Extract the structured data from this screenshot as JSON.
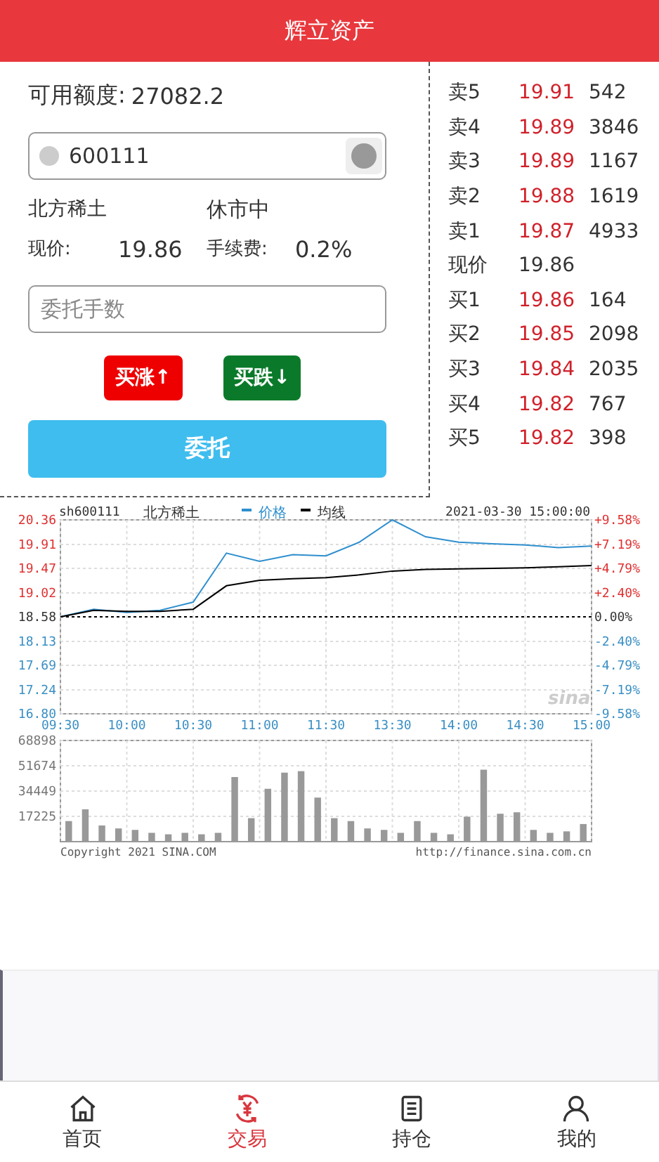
{
  "header": {
    "title": "辉立资产"
  },
  "account": {
    "label": "可用额度:",
    "value": "27082.2"
  },
  "code_field": {
    "value": "600111"
  },
  "stock": {
    "name": "北方稀土",
    "status": "休市中",
    "price_label": "现价:",
    "price": "19.86",
    "fee_label": "手续费:",
    "fee": "0.2%"
  },
  "quantity_field": {
    "placeholder": "委托手数"
  },
  "trade_buttons": [
    {
      "label": "买涨↑",
      "kind": "up"
    },
    {
      "label": "买跌↓",
      "kind": "down"
    }
  ],
  "submit_button": {
    "label": "委托"
  },
  "order_book": [
    {
      "label": "卖5",
      "price": "19.91",
      "volume": "542",
      "kind": "quote"
    },
    {
      "label": "卖4",
      "price": "19.89",
      "volume": "3846",
      "kind": "quote"
    },
    {
      "label": "卖3",
      "price": "19.89",
      "volume": "1167",
      "kind": "quote"
    },
    {
      "label": "卖2",
      "price": "19.88",
      "volume": "1619",
      "kind": "quote"
    },
    {
      "label": "卖1",
      "price": "19.87",
      "volume": "4933",
      "kind": "quote"
    },
    {
      "label": "现价",
      "price": "19.86",
      "kind": "current"
    },
    {
      "label": "买1",
      "price": "19.86",
      "volume": "164",
      "kind": "quote"
    },
    {
      "label": "买2",
      "price": "19.85",
      "volume": "2098",
      "kind": "quote"
    },
    {
      "label": "买3",
      "price": "19.84",
      "volume": "2035",
      "kind": "quote"
    },
    {
      "label": "买4",
      "price": "19.82",
      "volume": "767",
      "kind": "quote"
    },
    {
      "label": "买5",
      "price": "19.82",
      "volume": "398",
      "kind": "quote"
    }
  ],
  "price_chart": {
    "symbol": "sh600111",
    "name": "北方稀土",
    "datetime": "2021-03-30 15:00:00",
    "logo": "sina",
    "percent_ticks": [
      "+9.58%",
      "+7.19%",
      "+4.79%",
      "+2.40%",
      "0.00%",
      "-2.40%",
      "-4.79%",
      "-7.19%",
      "-9.58%"
    ],
    "chart_data": {
      "type": "line",
      "categories": [
        "09:30",
        null,
        "10:00",
        null,
        "10:30",
        null,
        "11:00",
        null,
        "11:30",
        null,
        "13:30",
        null,
        "14:00",
        null,
        "14:30",
        null,
        "15:00"
      ],
      "series": [
        {
          "name": "价格",
          "color": "#2f8fce",
          "values": [
            18.58,
            18.72,
            18.66,
            18.7,
            18.85,
            19.75,
            19.6,
            19.72,
            19.7,
            19.95,
            20.36,
            20.05,
            19.95,
            19.92,
            19.9,
            19.85,
            19.88
          ]
        },
        {
          "name": "均线",
          "color": "#000000",
          "values": [
            18.58,
            18.7,
            18.68,
            18.68,
            18.72,
            19.15,
            19.25,
            19.28,
            19.3,
            19.35,
            19.42,
            19.45,
            19.46,
            19.47,
            19.48,
            19.5,
            19.52
          ]
        }
      ],
      "ylim": [
        16.8,
        20.36
      ],
      "grid": true,
      "legend": "top",
      "ref_lines": [
        {
          "axis": "y",
          "value": 18.58
        }
      ],
      "yticks": [
        {
          "value": 20.36,
          "label": "20.36"
        },
        {
          "value": 19.91,
          "label": "19.91"
        },
        {
          "value": 19.47,
          "label": "19.47"
        },
        {
          "value": 19.02,
          "label": "19.02"
        },
        {
          "value": 18.58,
          "label": "18.58"
        },
        {
          "value": 18.13,
          "label": "18.13"
        },
        {
          "value": 17.69,
          "label": "17.69"
        },
        {
          "value": 17.24,
          "label": "17.24"
        },
        {
          "value": 16.8,
          "label": "16.80"
        }
      ]
    }
  },
  "volume_chart": {
    "copyright": "Copyright 2021 SINA.COM",
    "url": "http://finance.sina.com.cn",
    "chart_data": {
      "type": "bar",
      "values": [
        14000,
        22000,
        11000,
        9000,
        8000,
        6000,
        5000,
        6000,
        5000,
        6000,
        44000,
        16000,
        36000,
        47000,
        48000,
        30000,
        16000,
        14000,
        9000,
        8000,
        6000,
        14000,
        6000,
        5000,
        17000,
        49000,
        19000,
        20000,
        8000,
        6000,
        7000,
        12000
      ],
      "ylim": [
        0,
        68898
      ],
      "grid": true,
      "yticks": [
        {
          "value": 17225,
          "label": "17225"
        },
        {
          "value": 34449,
          "label": "34449"
        },
        {
          "value": 51674,
          "label": "51674"
        },
        {
          "value": 68898,
          "label": "68898"
        }
      ]
    }
  },
  "tabbar": [
    {
      "label": "首页",
      "selected": false
    },
    {
      "label": "交易",
      "selected": true
    },
    {
      "label": "持仓",
      "selected": false
    },
    {
      "label": "我的",
      "selected": false
    }
  ]
}
